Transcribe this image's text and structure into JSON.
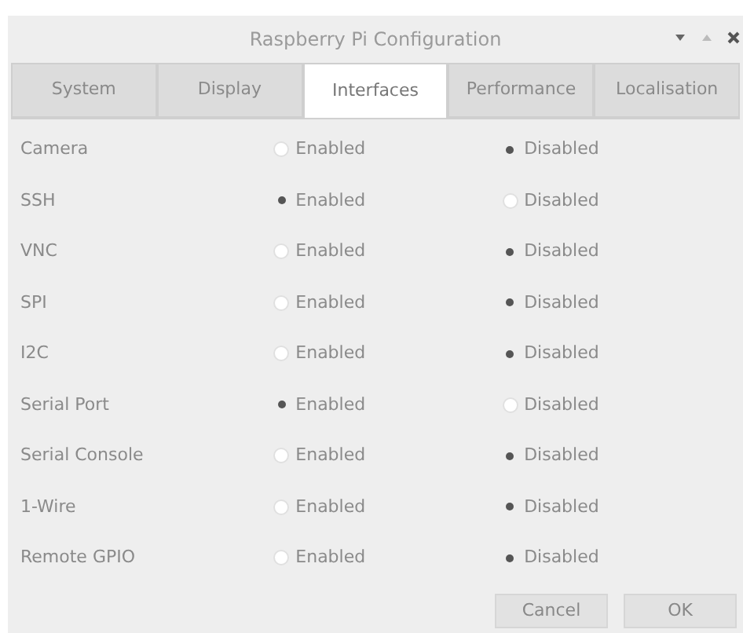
{
  "window": {
    "title": "Raspberry Pi Configuration"
  },
  "tabs": [
    {
      "label": "System",
      "selected": false
    },
    {
      "label": "Display",
      "selected": false
    },
    {
      "label": "Interfaces",
      "selected": true
    },
    {
      "label": "Performance",
      "selected": false
    },
    {
      "label": "Localisation",
      "selected": false
    }
  ],
  "interfaces": [
    {
      "name": "Camera",
      "options": [
        {
          "label": "Enabled",
          "selected": false
        },
        {
          "label": "Disabled",
          "selected": true
        }
      ]
    },
    {
      "name": "SSH",
      "options": [
        {
          "label": "Enabled",
          "selected": true
        },
        {
          "label": "Disabled",
          "selected": false
        }
      ]
    },
    {
      "name": "VNC",
      "options": [
        {
          "label": "Enabled",
          "selected": false
        },
        {
          "label": "Disabled",
          "selected": true
        }
      ]
    },
    {
      "name": "SPI",
      "options": [
        {
          "label": "Enabled",
          "selected": false
        },
        {
          "label": "Disabled",
          "selected": true
        }
      ]
    },
    {
      "name": "I2C",
      "options": [
        {
          "label": "Enabled",
          "selected": false
        },
        {
          "label": "Disabled",
          "selected": true
        }
      ]
    },
    {
      "name": "Serial Port",
      "options": [
        {
          "label": "Enabled",
          "selected": true
        },
        {
          "label": "Disabled",
          "selected": false
        }
      ]
    },
    {
      "name": "Serial Console",
      "options": [
        {
          "label": "Enabled",
          "selected": false
        },
        {
          "label": "Disabled",
          "selected": true
        }
      ]
    },
    {
      "name": "1-Wire",
      "options": [
        {
          "label": "Enabled",
          "selected": false
        },
        {
          "label": "Disabled",
          "selected": true
        }
      ]
    },
    {
      "name": "Remote GPIO",
      "options": [
        {
          "label": "Enabled",
          "selected": false
        },
        {
          "label": "Disabled",
          "selected": true
        }
      ]
    }
  ],
  "buttons": [
    "Cancel",
    "OK"
  ]
}
